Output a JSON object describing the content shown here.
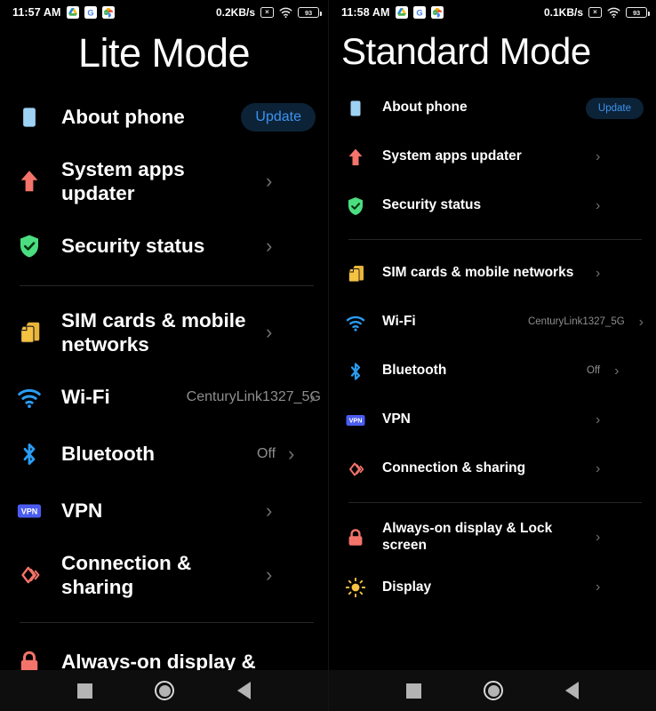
{
  "left": {
    "status": {
      "time": "11:57 AM",
      "apps": [
        "google-drive",
        "google-search",
        "google-photos"
      ],
      "net_speed": "0.2KB/s",
      "sim_icon": "no-sim-icon",
      "sim_glyph": "×",
      "wifi_icon": "wifi-icon",
      "battery_level": "93"
    },
    "title": "Lite Mode",
    "rows": [
      {
        "name": "about-phone",
        "icon": "phone-square-icon",
        "label": "About phone",
        "value": "",
        "action": "Update",
        "chevron": false
      },
      {
        "name": "system-apps-updater",
        "icon": "up-arrow-icon",
        "label": "System apps updater",
        "value": "",
        "action": "",
        "chevron": true
      },
      {
        "name": "security-status",
        "icon": "shield-check-icon",
        "label": "Security status",
        "value": "",
        "action": "",
        "chevron": true
      },
      {
        "divider": true
      },
      {
        "name": "sim-cards",
        "icon": "sim-card-icon",
        "label": "SIM cards & mobile networks",
        "value": "",
        "action": "",
        "chevron": true
      },
      {
        "name": "wifi",
        "icon": "wifi-icon",
        "label": "Wi-Fi",
        "value": "CenturyLink1327_5G",
        "action": "",
        "chevron": true
      },
      {
        "name": "bluetooth",
        "icon": "bluetooth-icon",
        "label": "Bluetooth",
        "value": "Off",
        "action": "",
        "chevron": true
      },
      {
        "name": "vpn",
        "icon": "vpn-badge-icon",
        "label": "VPN",
        "value": "",
        "action": "",
        "chevron": true
      },
      {
        "name": "connection-sharing",
        "icon": "connection-share-icon",
        "label": "Connection & sharing",
        "value": "",
        "action": "",
        "chevron": true
      },
      {
        "divider": true
      },
      {
        "name": "always-on-display",
        "icon": "lock-icon",
        "label": "Always-on display &",
        "value": "",
        "action": "",
        "chevron": false
      }
    ]
  },
  "right": {
    "status": {
      "time": "11:58 AM",
      "apps": [
        "google-drive",
        "google-search",
        "google-photos"
      ],
      "net_speed": "0.1KB/s",
      "sim_icon": "no-sim-icon",
      "sim_glyph": "×",
      "wifi_icon": "wifi-icon",
      "battery_level": "93"
    },
    "title": "Standard Mode",
    "rows": [
      {
        "name": "about-phone",
        "icon": "phone-square-icon",
        "label": "About phone",
        "value": "",
        "action": "Update",
        "chevron": false
      },
      {
        "name": "system-apps-updater",
        "icon": "up-arrow-icon",
        "label": "System apps updater",
        "value": "",
        "action": "",
        "chevron": true
      },
      {
        "name": "security-status",
        "icon": "shield-check-icon",
        "label": "Security status",
        "value": "",
        "action": "",
        "chevron": true
      },
      {
        "divider": true
      },
      {
        "name": "sim-cards",
        "icon": "sim-card-icon",
        "label": "SIM cards & mobile networks",
        "value": "",
        "action": "",
        "chevron": true
      },
      {
        "name": "wifi",
        "icon": "wifi-icon",
        "label": "Wi-Fi",
        "value": "CenturyLink1327_5G",
        "action": "",
        "chevron": true
      },
      {
        "name": "bluetooth",
        "icon": "bluetooth-icon",
        "label": "Bluetooth",
        "value": "Off",
        "action": "",
        "chevron": true
      },
      {
        "name": "vpn",
        "icon": "vpn-badge-icon",
        "label": "VPN",
        "value": "",
        "action": "",
        "chevron": true
      },
      {
        "name": "connection-sharing",
        "icon": "connection-share-icon",
        "label": "Connection & sharing",
        "value": "",
        "action": "",
        "chevron": true
      },
      {
        "divider": true
      },
      {
        "name": "always-on-display",
        "icon": "lock-icon",
        "label": "Always-on display & Lock screen",
        "value": "",
        "action": "",
        "chevron": true
      },
      {
        "name": "display",
        "icon": "brightness-icon",
        "label": "Display",
        "value": "",
        "action": "",
        "chevron": true
      }
    ]
  },
  "navbar": {
    "recents": "recents-square-icon",
    "home": "home-circle-icon",
    "back": "back-triangle-icon"
  },
  "colors": {
    "background": "#000000",
    "text": "#ffffff",
    "secondary_text": "#8e8e8e",
    "divider": "#262626",
    "update_bg": "#0c2236",
    "update_text": "#3d93f0",
    "icon_blue": "#8ecdf5",
    "icon_red": "#f4736a",
    "icon_green": "#4ade80",
    "icon_yellow": "#f5c242",
    "icon_wifi": "#2a9df4",
    "icon_bluetooth": "#2a9df4",
    "icon_vpn": "#4a5cf0",
    "navbar_bg": "#0e0e0e",
    "navbar_glyph": "#b4b4b4"
  }
}
